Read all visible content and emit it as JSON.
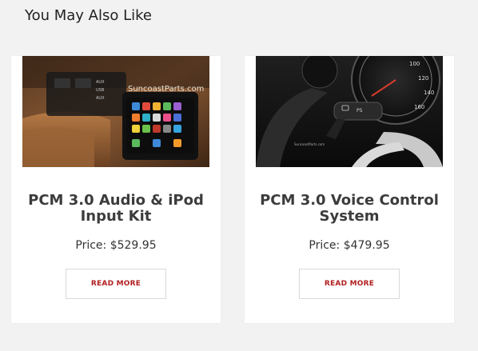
{
  "section": {
    "title": "You May Also Like"
  },
  "products": [
    {
      "name": "PCM 3.0 Audio & iPod Input Kit",
      "price_text": "Price: $529.95",
      "button_label": "READ MORE",
      "image": {
        "watermark": "SuncoastParts.com",
        "console_labels": [
          "AUX",
          "USB",
          "AUX"
        ],
        "icon": "ipod-console-photo"
      }
    },
    {
      "name": "PCM 3.0 Voice Control System",
      "price_text": "Price: $479.95",
      "button_label": "READ MORE",
      "image": {
        "watermark": "SuncoastParts.com",
        "stalk_label": "PS",
        "icon": "steering-stalk-photo"
      }
    }
  ],
  "colors": {
    "page_background": "#f2f2f2",
    "card_background": "#ffffff",
    "accent_red": "#b01e1e",
    "title_text": "#3c3c3c"
  }
}
